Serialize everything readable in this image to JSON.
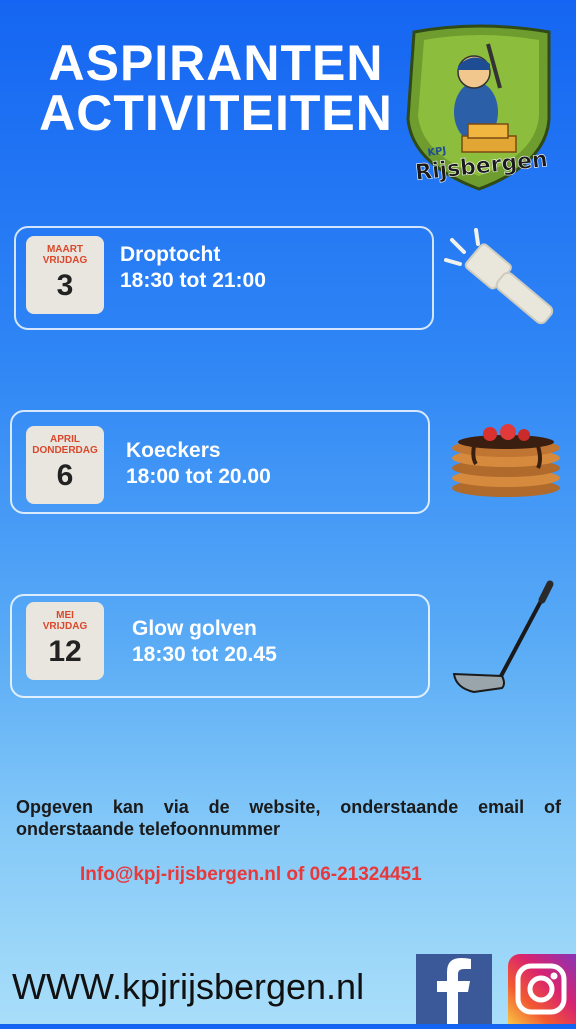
{
  "header": {
    "title_line1": "ASPIRANTEN",
    "title_line2": "ACTIVITEITEN"
  },
  "logo": {
    "line1": "KPJ",
    "line2": "Rijsbergen"
  },
  "events": [
    {
      "month": "MAART",
      "weekday": "VRIJDAG",
      "day": "3",
      "name": "Droptocht",
      "time": "18:30 tot 21:00",
      "icon": "flashlight-icon"
    },
    {
      "month": "APRIL",
      "weekday": "DONDERDAG",
      "day": "6",
      "name": "Koeckers",
      "time": "18:00 tot 20.00",
      "icon": "pancakes-icon"
    },
    {
      "month": "MEI",
      "weekday": "VRIJDAG",
      "day": "12",
      "name": "Glow golven",
      "time": "18:30 tot 20.45",
      "icon": "golf-club-icon"
    }
  ],
  "info": {
    "text": "Opgeven kan via de website, onderstaande email of onderstaande telefoonnummer"
  },
  "contact": {
    "text": "Info@kpj-rijsbergen.nl of 06-21324451"
  },
  "footer": {
    "website": "WWW.kpjrijsbergen.nl"
  },
  "social": {
    "facebook_icon": "facebook-icon",
    "instagram_icon": "instagram-icon"
  },
  "colors": {
    "accent_red": "#e8383a",
    "date_red": "#d9482b"
  }
}
